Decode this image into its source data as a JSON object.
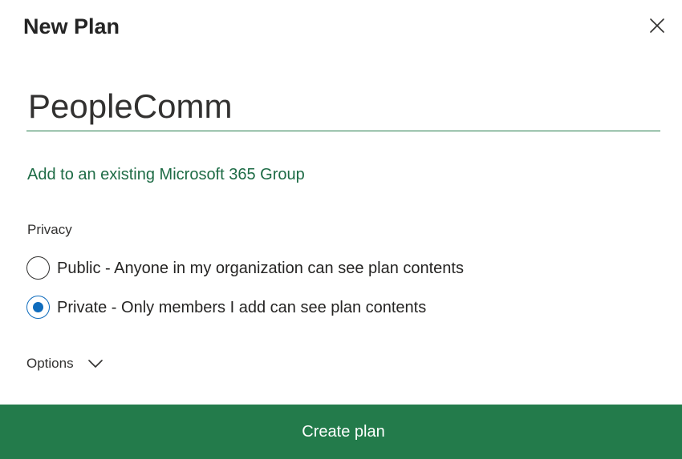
{
  "dialog": {
    "title": "New Plan",
    "close_icon": "close-icon"
  },
  "plan_name": {
    "value": "PeopleComm",
    "placeholder": ""
  },
  "group_link": {
    "label": "Add to an existing Microsoft 365 Group"
  },
  "privacy": {
    "label": "Privacy",
    "options": [
      {
        "label": "Public - Anyone in my organization can see plan contents",
        "selected": false
      },
      {
        "label": "Private - Only members I add can see plan contents",
        "selected": true
      }
    ]
  },
  "options": {
    "label": "Options",
    "icon": "chevron-down-icon"
  },
  "create_button": {
    "label": "Create plan"
  },
  "colors": {
    "accent_green": "#237b4b",
    "link_green": "#1d6b45",
    "radio_blue": "#0f6cbd"
  }
}
